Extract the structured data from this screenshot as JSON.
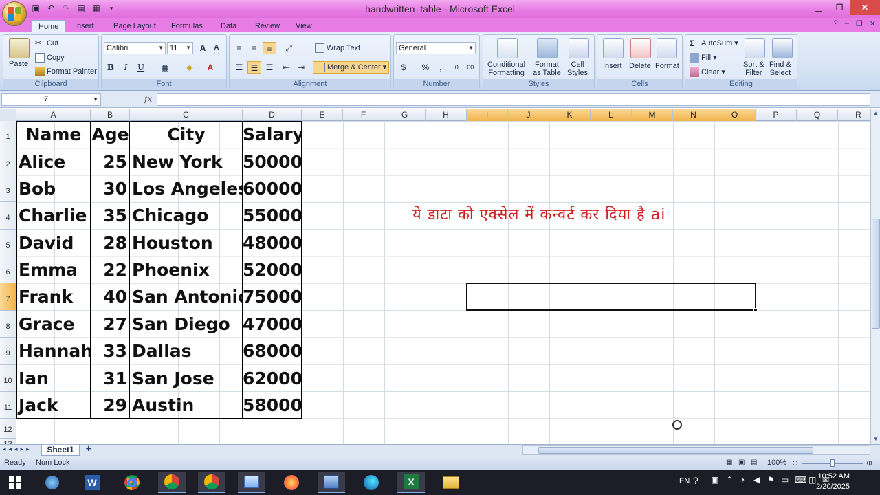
{
  "window": {
    "title": "handwritten_table - Microsoft Excel"
  },
  "ribbon_tabs": [
    "Home",
    "Insert",
    "Page Layout",
    "Formulas",
    "Data",
    "Review",
    "View"
  ],
  "clipboard": {
    "paste": "Paste",
    "cut": "Cut",
    "copy": "Copy",
    "format_painter": "Format Painter",
    "label": "Clipboard"
  },
  "font": {
    "name": "Calibri",
    "size": "11",
    "bold": "B",
    "italic": "I",
    "underline": "U",
    "label": "Font"
  },
  "alignment": {
    "wrap_text": "Wrap Text",
    "merge_center": "Merge & Center",
    "label": "Alignment"
  },
  "number": {
    "format": "General",
    "currency": "$",
    "percent": "%",
    "comma": ",",
    "label": "Number"
  },
  "styles": {
    "conditional_formatting": [
      "Conditional",
      "Formatting"
    ],
    "format_as_table": [
      "Format",
      "as Table"
    ],
    "cell_styles": [
      "Cell",
      "Styles"
    ],
    "label": "Styles"
  },
  "cells_group": {
    "insert": "Insert",
    "delete": "Delete",
    "format": "Format",
    "label": "Cells"
  },
  "editing": {
    "autosum": "AutoSum",
    "fill": "Fill",
    "clear": "Clear",
    "sort_filter": [
      "Sort &",
      "Filter"
    ],
    "find_select": [
      "Find &",
      "Select"
    ],
    "label": "Editing"
  },
  "formula_bar": {
    "name_box": "I7",
    "fx": "fx",
    "content": ""
  },
  "columns": [
    "A",
    "B",
    "C",
    "D",
    "E",
    "F",
    "G",
    "H",
    "I",
    "J",
    "K",
    "L",
    "M",
    "N",
    "O",
    "P",
    "Q",
    "R"
  ],
  "rows": [
    "1",
    "2",
    "3",
    "4",
    "5",
    "6",
    "7",
    "8",
    "9",
    "10",
    "11",
    "12",
    "13"
  ],
  "table": {
    "headers": [
      "Name",
      "Age",
      "City",
      "Salary"
    ],
    "rows": [
      [
        "Alice",
        "25",
        "New York",
        "50000"
      ],
      [
        "Bob",
        "30",
        "Los Angeles",
        "60000"
      ],
      [
        "Charlie",
        "35",
        "Chicago",
        "55000"
      ],
      [
        "David",
        "28",
        "Houston",
        "48000"
      ],
      [
        "Emma",
        "22",
        "Phoenix",
        "52000"
      ],
      [
        "Frank",
        "40",
        "San Antonio",
        "75000"
      ],
      [
        "Grace",
        "27",
        "San Diego",
        "47000"
      ],
      [
        "Hannah",
        "33",
        "Dallas",
        "68000"
      ],
      [
        "Ian",
        "31",
        "San Jose",
        "62000"
      ],
      [
        "Jack",
        "29",
        "Austin",
        "58000"
      ]
    ]
  },
  "annotation": "ये डाटा को एक्सेल में कन्वर्ट कर दिया है ai",
  "sheet_tab": "Sheet1",
  "status": {
    "ready": "Ready",
    "num_lock": "Num Lock",
    "zoom": "100%"
  },
  "taskbar": {
    "lang": "EN",
    "time": "10:52 AM",
    "date": "2/20/2025"
  },
  "colors": {
    "title_bar": "#e77de4",
    "annotation": "#d11e1e",
    "selected_header": "#f2b44b"
  }
}
